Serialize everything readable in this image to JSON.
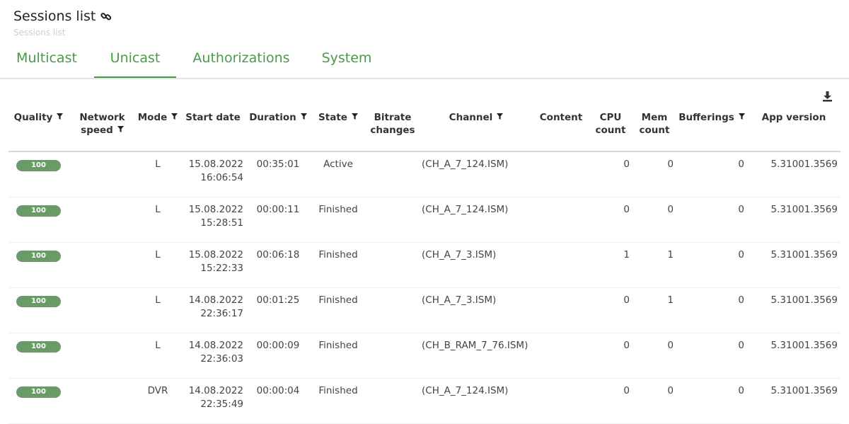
{
  "page": {
    "title": "Sessions list",
    "subtitle": "Sessions list"
  },
  "tabs": [
    {
      "label": "Multicast",
      "active": false
    },
    {
      "label": "Unicast",
      "active": true
    },
    {
      "label": "Authorizations",
      "active": false
    },
    {
      "label": "System",
      "active": false
    }
  ],
  "colors": {
    "accent": "#4a9a4a",
    "badge": "#6a9a67"
  },
  "table": {
    "headers": {
      "quality": "Quality",
      "network_speed": "Network speed",
      "mode": "Mode",
      "start_date": "Start date",
      "duration": "Duration",
      "state": "State",
      "bitrate_changes": "Bitrate changes",
      "channel": "Channel",
      "content": "Content",
      "cpu_count": "CPU count",
      "mem_count": "Mem count",
      "bufferings": "Bufferings",
      "app_version": "App version"
    },
    "rows": [
      {
        "quality": "100",
        "network_speed": "",
        "mode": "L",
        "start_date": "15.08.2022",
        "start_time": "16:06:54",
        "duration": "00:35:01",
        "state": "Active",
        "bitrate_changes": "",
        "channel": "(CH_A_7_124.ISM)",
        "content": "",
        "cpu_count": "0",
        "mem_count": "0",
        "bufferings": "0",
        "app_version": "5.31001.3569"
      },
      {
        "quality": "100",
        "network_speed": "",
        "mode": "L",
        "start_date": "15.08.2022",
        "start_time": "15:28:51",
        "duration": "00:00:11",
        "state": "Finished",
        "bitrate_changes": "",
        "channel": "(CH_A_7_124.ISM)",
        "content": "",
        "cpu_count": "0",
        "mem_count": "0",
        "bufferings": "0",
        "app_version": "5.31001.3569"
      },
      {
        "quality": "100",
        "network_speed": "",
        "mode": "L",
        "start_date": "15.08.2022",
        "start_time": "15:22:33",
        "duration": "00:06:18",
        "state": "Finished",
        "bitrate_changes": "",
        "channel": "(CH_A_7_3.ISM)",
        "content": "",
        "cpu_count": "1",
        "mem_count": "1",
        "bufferings": "0",
        "app_version": "5.31001.3569"
      },
      {
        "quality": "100",
        "network_speed": "",
        "mode": "L",
        "start_date": "14.08.2022",
        "start_time": "22:36:17",
        "duration": "00:01:25",
        "state": "Finished",
        "bitrate_changes": "",
        "channel": "(CH_A_7_3.ISM)",
        "content": "",
        "cpu_count": "0",
        "mem_count": "1",
        "bufferings": "0",
        "app_version": "5.31001.3569"
      },
      {
        "quality": "100",
        "network_speed": "",
        "mode": "L",
        "start_date": "14.08.2022",
        "start_time": "22:36:03",
        "duration": "00:00:09",
        "state": "Finished",
        "bitrate_changes": "",
        "channel": "(CH_B_RAM_7_76.ISM)",
        "content": "",
        "cpu_count": "0",
        "mem_count": "0",
        "bufferings": "0",
        "app_version": "5.31001.3569"
      },
      {
        "quality": "100",
        "network_speed": "",
        "mode": "DVR",
        "start_date": "14.08.2022",
        "start_time": "22:35:49",
        "duration": "00:00:04",
        "state": "Finished",
        "bitrate_changes": "",
        "channel": "(CH_A_7_124.ISM)",
        "content": "",
        "cpu_count": "0",
        "mem_count": "0",
        "bufferings": "0",
        "app_version": "5.31001.3569"
      }
    ]
  }
}
